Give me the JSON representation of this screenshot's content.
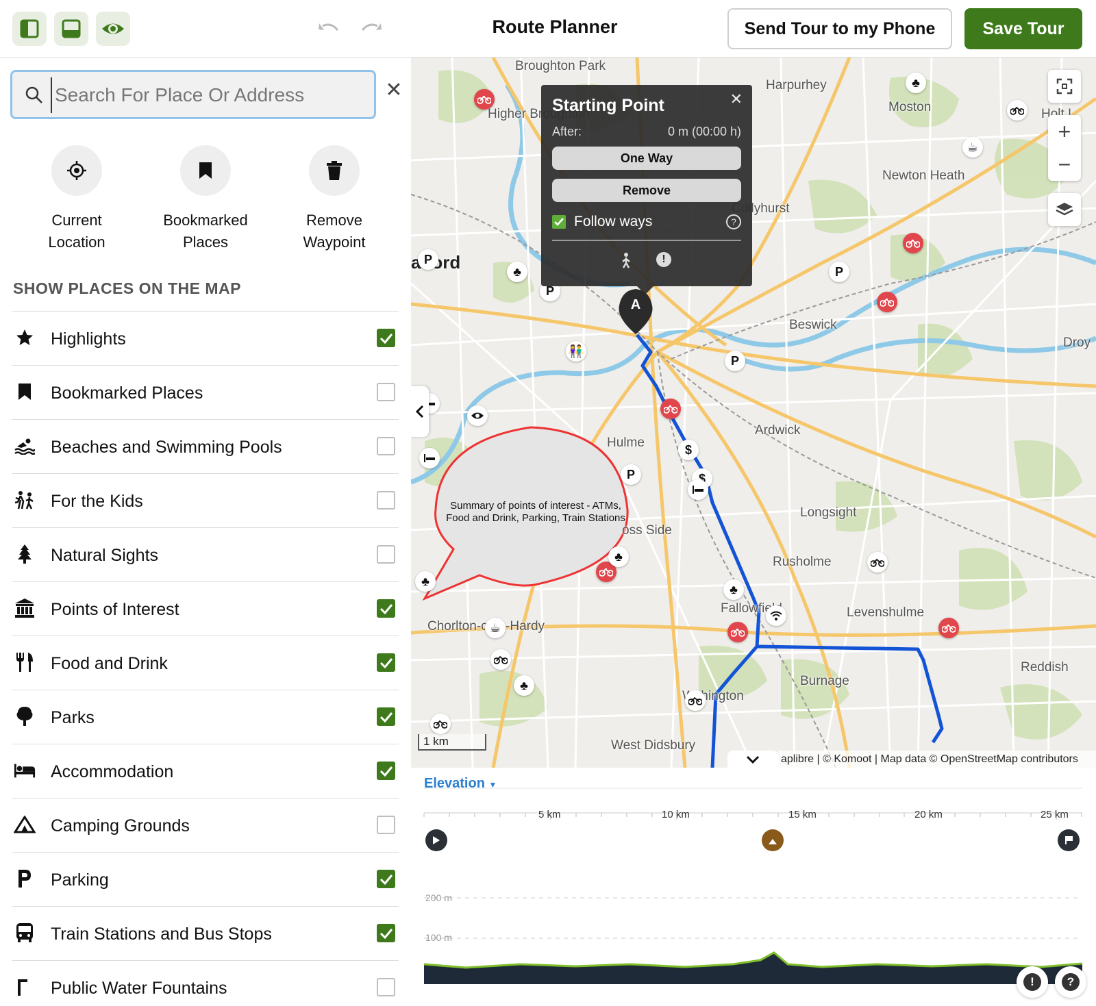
{
  "header": {
    "title": "Route Planner",
    "send_label": "Send Tour to my Phone",
    "save_label": "Save Tour"
  },
  "search": {
    "placeholder": "Search For Place Or Address",
    "value": ""
  },
  "quick_actions": [
    {
      "line1": "Current",
      "line2": "Location",
      "icon": "crosshair-icon"
    },
    {
      "line1": "Bookmarked",
      "line2": "Places",
      "icon": "bookmark-icon"
    },
    {
      "line1": "Remove",
      "line2": "Waypoint",
      "icon": "trash-icon"
    }
  ],
  "places_section_title": "SHOW PLACES ON THE MAP",
  "places": [
    {
      "label": "Highlights",
      "icon": "star-icon",
      "checked": true
    },
    {
      "label": "Bookmarked Places",
      "icon": "bookmark-icon",
      "checked": false
    },
    {
      "label": "Beaches and Swimming Pools",
      "icon": "swimmer-icon",
      "checked": false
    },
    {
      "label": "For the Kids",
      "icon": "kids-icon",
      "checked": false
    },
    {
      "label": "Natural Sights",
      "icon": "tree-icon",
      "checked": false
    },
    {
      "label": "Points of Interest",
      "icon": "monument-icon",
      "checked": true
    },
    {
      "label": "Food and Drink",
      "icon": "cutlery-icon",
      "checked": true
    },
    {
      "label": "Parks",
      "icon": "park-tree-icon",
      "checked": true
    },
    {
      "label": "Accommodation",
      "icon": "bed-icon",
      "checked": true
    },
    {
      "label": "Camping Grounds",
      "icon": "tent-icon",
      "checked": false
    },
    {
      "label": "Parking",
      "icon": "parking-icon",
      "checked": true
    },
    {
      "label": "Train Stations and Bus Stops",
      "icon": "bus-icon",
      "checked": true
    },
    {
      "label": "Public Water Fountains",
      "icon": "fountain-icon",
      "checked": false
    }
  ],
  "map": {
    "labels": {
      "broughton_park": "Broughton Park",
      "harpurhey": "Harpurhey",
      "moston": "Moston",
      "higher_broughton": "Higher Broughton",
      "newton_heath": "Newton Heath",
      "colyhurst": "Collyhurst",
      "salford": "alford",
      "beswick": "Beswick",
      "droylsden": "Droy",
      "ardwick": "Ardwick",
      "hulme": "Hulme",
      "longsight": "Longsight",
      "moss_side": "oss Side",
      "rusholme": "Rusholme",
      "fallowfield": "Fallowfield",
      "levenshulme": "Levenshulme",
      "chorlton": "Chorlton-cum-Hardy",
      "reddish": "Reddish",
      "burnage": "Burnage",
      "withington": "Withington",
      "west_didsbury": "West Didsbury",
      "holt": "Holt L"
    },
    "popup": {
      "title": "Starting Point",
      "after_label": "After:",
      "after_value": "0 m (00:00 h)",
      "one_way": "One Way",
      "remove": "Remove",
      "follow_ways": "Follow ways",
      "follow_checked": true
    },
    "waypoint": "A",
    "callout": "Summary of points of interest - ATMs, Food and Drink, Parking, Train Stations",
    "scale": "1 km",
    "attribution": "aplibre | © Komoot | Map data © OpenStreetMap contributors",
    "route_color": "#1353d6"
  },
  "elevation": {
    "title": "Elevation",
    "km_ticks": [
      "5 km",
      "10 km",
      "15 km",
      "20 km",
      "25 km"
    ],
    "y_ticks": [
      "200 m",
      "100 m"
    ]
  },
  "colors": {
    "accent_green": "#3e7a1b",
    "link_blue": "#2a7fd0",
    "poi_red": "#e0464b"
  }
}
